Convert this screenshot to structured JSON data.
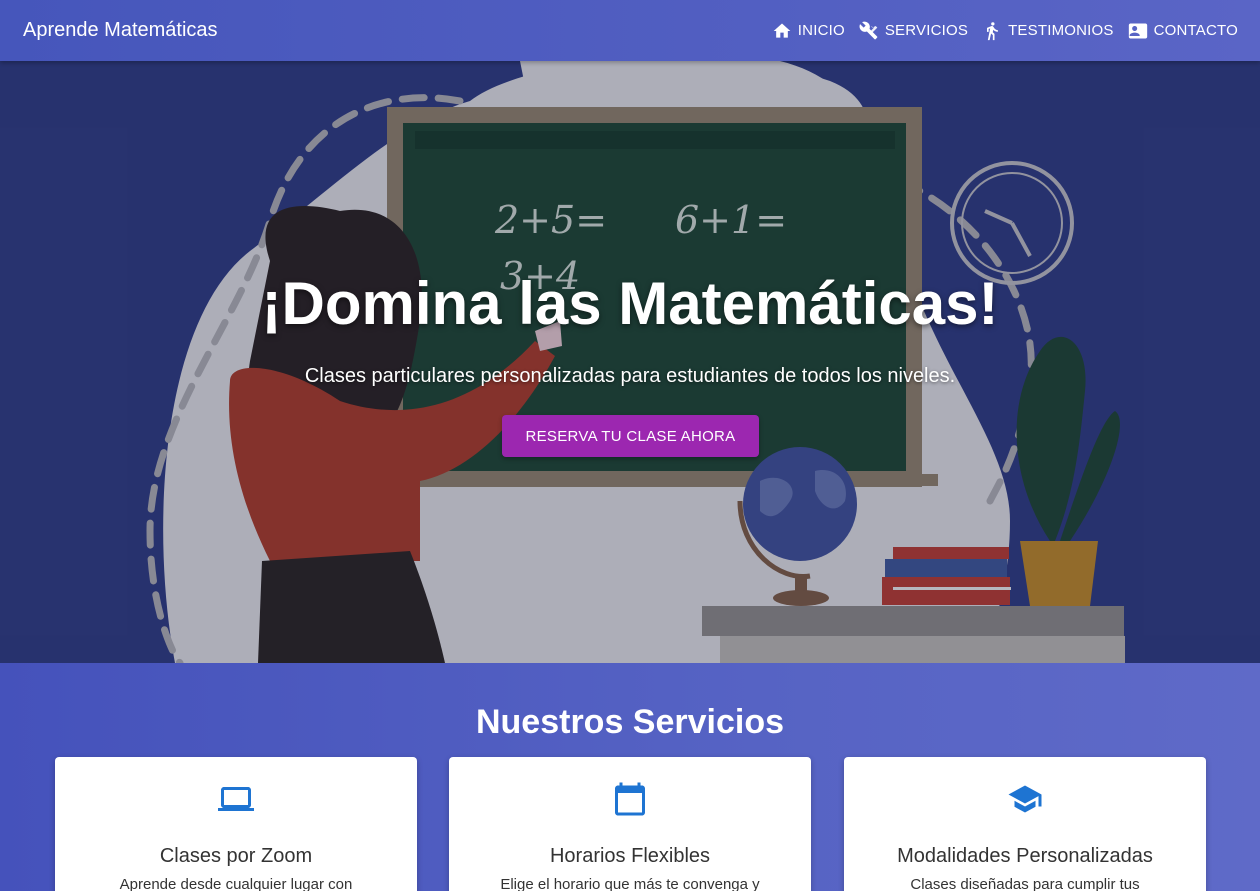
{
  "brand": "Aprende Matemáticas",
  "nav": {
    "inicio": "INICIO",
    "servicios": "SERVICIOS",
    "testimonios": "TESTIMONIOS",
    "contacto": "CONTACTO"
  },
  "hero": {
    "title": "¡Domina las Matemáticas!",
    "subtitle": "Clases particulares personalizadas para estudiantes de todos los niveles.",
    "cta": "RESERVA TU CLASE AHORA",
    "board_line1a": "2+5=",
    "board_line1b": "6+1=",
    "board_line2": "3+4"
  },
  "services": {
    "title": "Nuestros Servicios",
    "items": [
      {
        "icon": "laptop-icon",
        "title": "Clases por Zoom",
        "text": "Aprende desde cualquier lugar con"
      },
      {
        "icon": "calendar-icon",
        "title": "Horarios Flexibles",
        "text": "Elige el horario que más te convenga y"
      },
      {
        "icon": "graduation-cap-icon",
        "title": "Modalidades Personalizadas",
        "text": "Clases diseñadas para cumplir tus"
      }
    ]
  },
  "colors": {
    "navbar": "#4a5bc0",
    "cta": "#9c27b0",
    "icon_blue": "#1e74d2"
  }
}
